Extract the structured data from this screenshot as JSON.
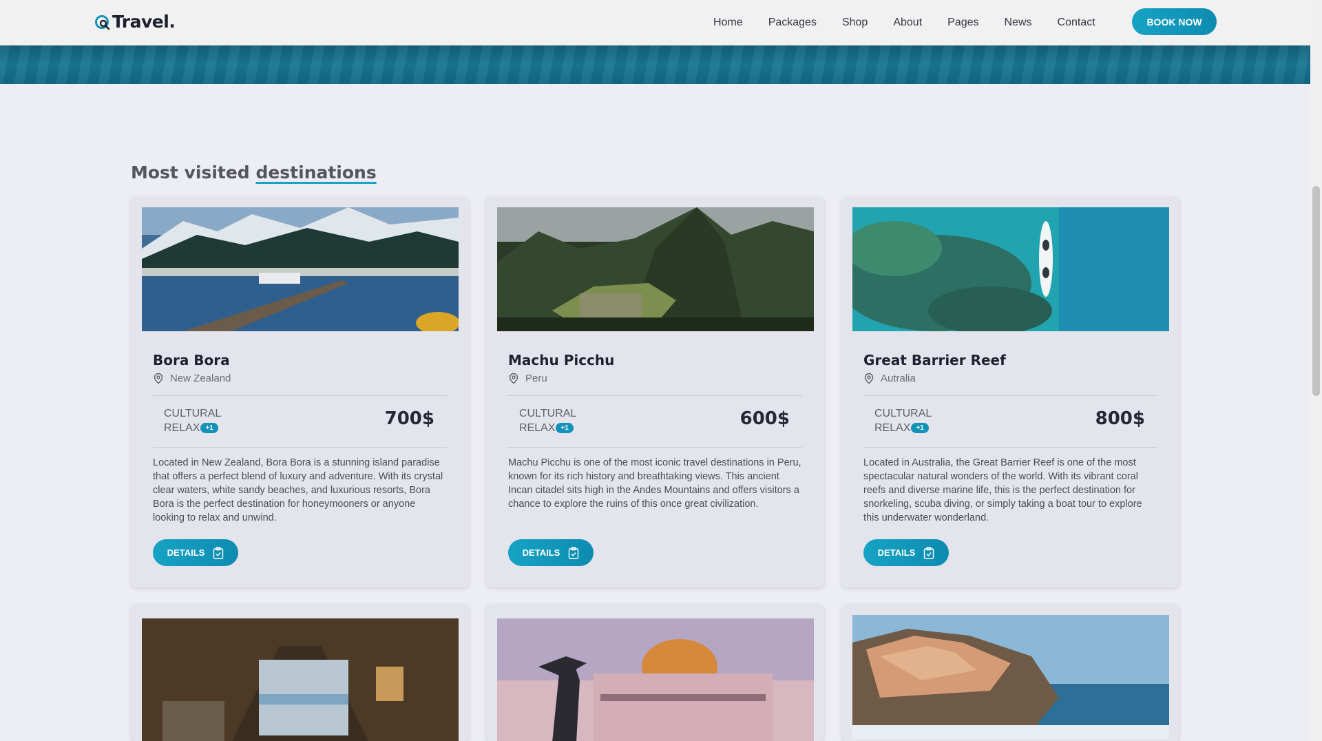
{
  "header": {
    "logo_text": "Travel.",
    "nav": [
      "Home",
      "Packages",
      "Shop",
      "About",
      "Pages",
      "News",
      "Contact"
    ],
    "book_label": "BOOK NOW"
  },
  "section": {
    "title_prefix": "Most visited",
    "title_accent": "destinations"
  },
  "cards": [
    {
      "name": "Bora Bora",
      "location": "New Zealand",
      "tag1": "CULTURAL",
      "tag2": "RELAX",
      "badge": "+1",
      "price": "700$",
      "description": "Located in New Zealand, Bora Bora is a stunning island paradise that offers a perfect blend of luxury and adventure. With its crystal clear waters, white sandy beaches, and luxurious resorts, Bora Bora is the perfect destination for honeymooners or anyone looking to relax and unwind.",
      "details_label": "DETAILS"
    },
    {
      "name": "Machu Picchu",
      "location": "Peru",
      "tag1": "CULTURAL",
      "tag2": "RELAX",
      "badge": "+1",
      "price": "600$",
      "description": "Machu Picchu is one of the most iconic travel destinations in Peru, known for its rich history and breathtaking views. This ancient Incan citadel sits high in the Andes Mountains and offers visitors a chance to explore the ruins of this once great civilization.",
      "details_label": "DETAILS"
    },
    {
      "name": "Great Barrier Reef",
      "location": "Autralia",
      "tag1": "CULTURAL",
      "tag2": "RELAX",
      "badge": "+1",
      "price": "800$",
      "description": "Located in Australia, the Great Barrier Reef is one of the most spectacular natural wonders of the world. With its vibrant coral reefs and diverse marine life, this is the perfect destination for snorkeling, scuba diving, or simply taking a boat tour to explore this underwater wonderland.",
      "details_label": "DETAILS"
    }
  ],
  "colors": {
    "accent": "#16a3c4",
    "background": "#edeef3",
    "card": "#e4e5ec"
  }
}
